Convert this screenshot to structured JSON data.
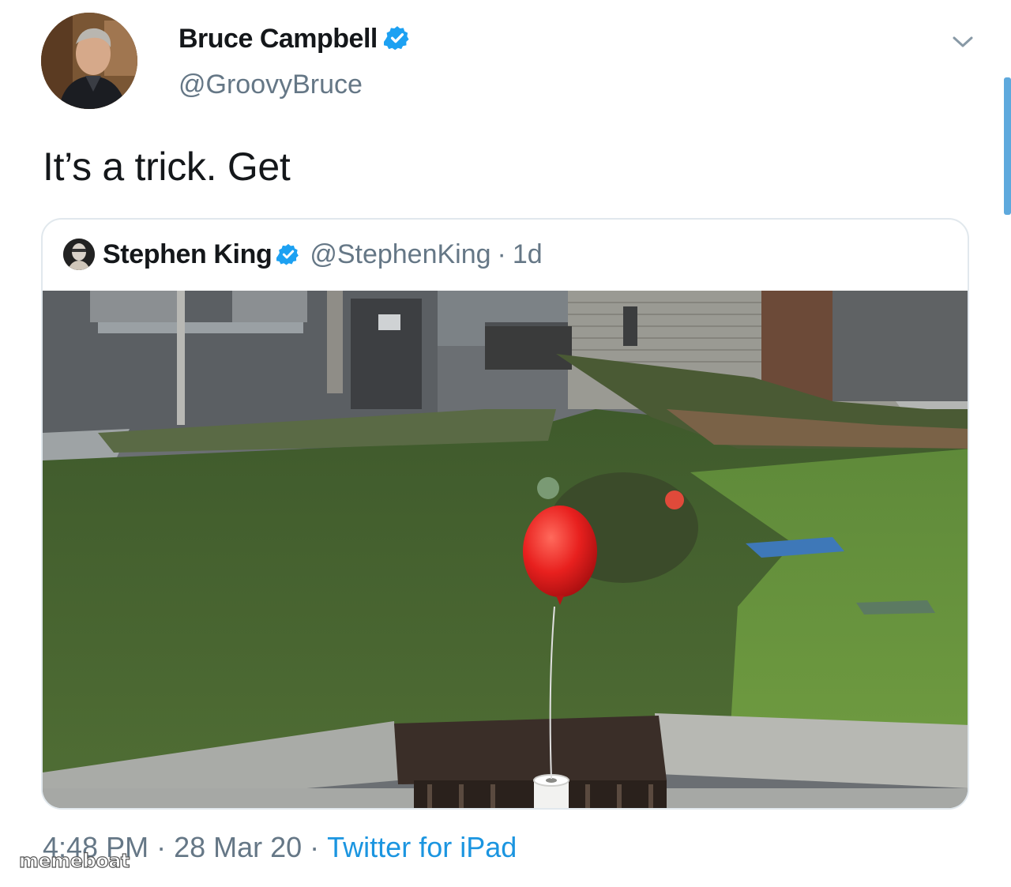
{
  "tweet": {
    "author": {
      "display_name": "Bruce Campbell",
      "handle": "@GroovyBruce",
      "verified": true
    },
    "text": "It’s a trick. Get",
    "quoted_tweet": {
      "display_name": "Stephen King",
      "handle": "@StephenKing",
      "separator": "·",
      "age": "1d",
      "verified": true,
      "media_description_icon": "photo-red-balloon-storm-drain"
    },
    "meta": {
      "time": "4:48 PM",
      "dot1": " · ",
      "date": "28 Mar 20",
      "dot2": " · ",
      "source": "Twitter for iPad"
    }
  },
  "watermark": "memeboat",
  "colors": {
    "verified_blue": "#1da1f2",
    "link_blue": "#1b95e0",
    "secondary_gray": "#657786",
    "balloon_red": "#e8201e"
  }
}
